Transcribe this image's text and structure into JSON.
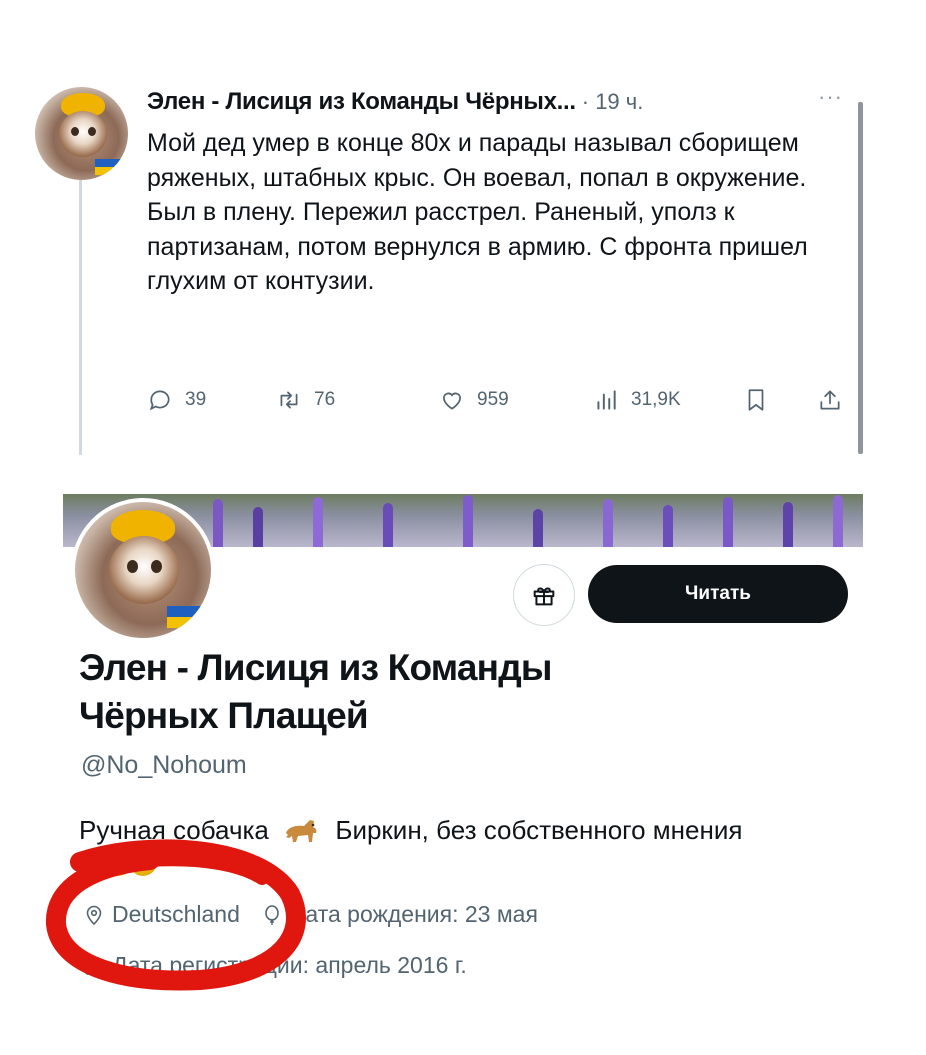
{
  "tweet": {
    "author_name": "Элен - Лисиця из Команды Чёрных...",
    "time": "· 19 ч.",
    "more": "···",
    "text": "Мой дед умер в конце 80х и парады называл сборищем ряженых, штабных крыс. Он воевал, попал в окружение. Был в плену. Пережил расстрел. Раненый, уполз к партизанам, потом вернулся в армию. С фронта пришел глухим от контузии.",
    "replies": "39",
    "retweets": "76",
    "likes": "959",
    "views": "31,9K"
  },
  "profile": {
    "name": "Элен - Лисиця из Команды Чёрных Плащей",
    "handle": "@No_Nohoum",
    "follow_label": "Читать",
    "bio_part1": "Ручная собачка",
    "bio_part2": "Биркин, без собственного мнения",
    "location": "Deutschland",
    "birthday": "Дата рождения: 23 мая",
    "joined": "Дата регистрации: апрель 2016 г."
  },
  "colors": {
    "text_primary": "#0f1419",
    "text_secondary": "#536471",
    "button_dark": "#0f1419",
    "annotation_red": "#e0170f",
    "ukraine_blue": "#1f5fbf",
    "ukraine_yellow": "#f2c200"
  }
}
